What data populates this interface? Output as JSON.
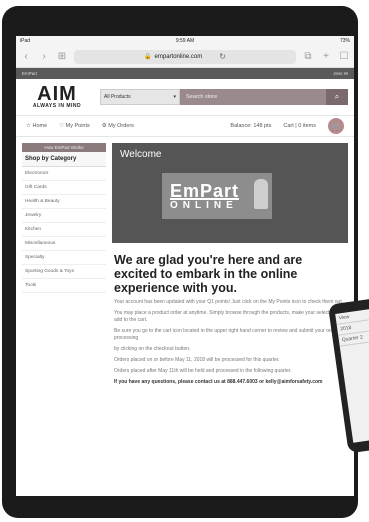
{
  "status": {
    "left": "iPad",
    "time": "9:59 AM",
    "right": "73%"
  },
  "browser": {
    "url": "empartonline.com",
    "back": "‹",
    "forward": "›",
    "book": "⊞",
    "tabs": "☐",
    "plus": "+",
    "share": "⧉"
  },
  "strip": {
    "left": "EmPart",
    "right": "Jess W"
  },
  "logo": {
    "big": "AIM",
    "small": "ALWAYS IN MIND"
  },
  "search": {
    "select": "All Products",
    "placeholder": "Search store"
  },
  "nav": {
    "home": "Home",
    "points": "My Points",
    "orders": "My Orders",
    "balance": "Balance: 148 pts",
    "cart": "Cart | 0 items"
  },
  "sidebar": {
    "top": "How EmPart Works",
    "heading": "Shop by Category",
    "items": [
      "Electronics",
      "Gift Cards",
      "Health & Beauty",
      "Jewelry",
      "Kitchen",
      "Miscellaneous",
      "Specialty",
      "Sporting Goods & Toys",
      "Tools"
    ]
  },
  "hero": {
    "welcome": "Welcome",
    "logo_top": "EmPart",
    "logo_bottom": "ONLINE"
  },
  "main": {
    "tagline": "We are glad you're here and are excited to embark in the online experience with you.",
    "p1": "Your account has been updated with your Q1 points! Just click on the My Points icon to check them out.",
    "p2": "You may place a product order at anytime. Simply browse through the products, make your selection and add to the cart.",
    "p3": "Be sure you go to the cart icon located in the upper right hand corner to review and submit your order for processing",
    "p4": "by clicking on the checkout button.",
    "p5": "Orders placed on or before May 11, 2018 will be processed for this quarter.",
    "p6": "Orders placed after May 11th will be held and processed in the following quarter.",
    "p7": "If you have any questions, please contact us at 888.447.6003 or kelly@aimforsafety.com"
  },
  "second_device": [
    "View",
    "2018",
    "Quarter 2"
  ]
}
